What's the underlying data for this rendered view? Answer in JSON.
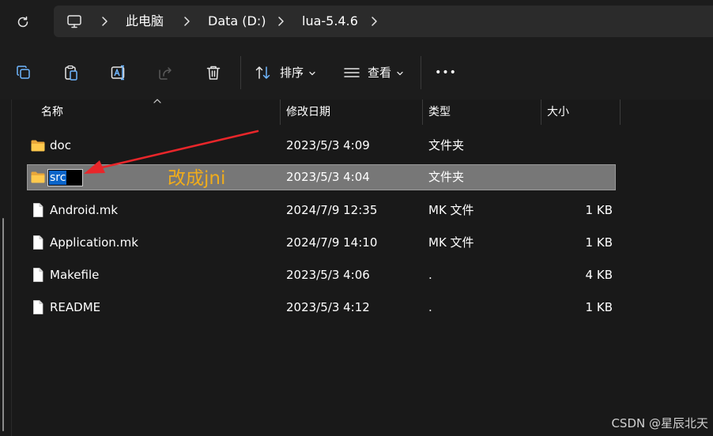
{
  "address_bar": {
    "crumbs": [
      "此电脑",
      "Data (D:)",
      "lua-5.4.6"
    ]
  },
  "toolbar": {
    "sort_label": "排序",
    "view_label": "查看",
    "more_label": "•••"
  },
  "columns": {
    "name": "名称",
    "date": "修改日期",
    "type": "类型",
    "size": "大小"
  },
  "files": [
    {
      "name": "doc",
      "date": "2023/5/3 4:09",
      "type": "文件夹",
      "size": "",
      "icon": "folder-icon"
    },
    {
      "name": "src",
      "date": "2023/5/3 4:04",
      "type": "文件夹",
      "size": "",
      "icon": "folder-icon",
      "selected": true,
      "renaming": true
    },
    {
      "name": "Android.mk",
      "date": "2024/7/9 12:35",
      "type": "MK 文件",
      "size": "1 KB",
      "icon": "file-icon"
    },
    {
      "name": "Application.mk",
      "date": "2024/7/9 14:10",
      "type": "MK 文件",
      "size": "1 KB",
      "icon": "file-icon"
    },
    {
      "name": "Makefile",
      "date": "2023/5/3 4:06",
      "type": ".",
      "size": "4 KB",
      "icon": "file-icon"
    },
    {
      "name": "README",
      "date": "2023/5/3 4:12",
      "type": ".",
      "size": "1 KB",
      "icon": "file-icon"
    }
  ],
  "annotation": {
    "text": "改成jni",
    "color": "#f0ac1b",
    "arrow_color": "#e8262a"
  },
  "watermark": "CSDN @星辰北天",
  "colors": {
    "background": "#191919",
    "selected_row": "#777777",
    "rename_highlight": "#0a64c8"
  }
}
